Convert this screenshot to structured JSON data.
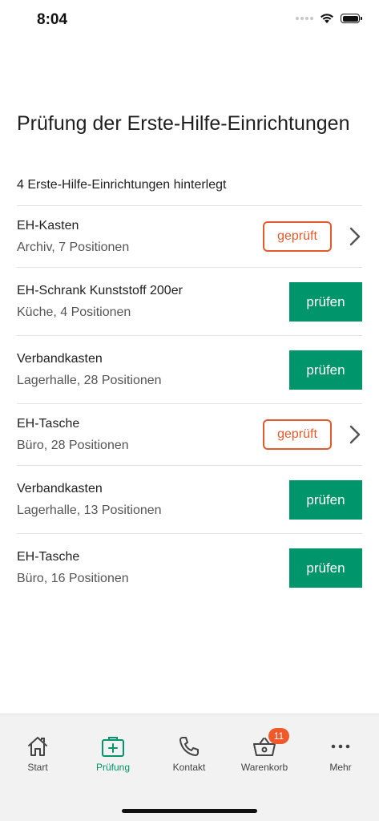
{
  "status_bar": {
    "time": "8:04"
  },
  "page": {
    "title": "Prüfung der Erste-Hilfe-Einrichtungen",
    "count_label": "4 Erste-Hilfe-Einrichtungen hinterlegt"
  },
  "items": [
    {
      "title": "EH-Kasten",
      "subtitle": "Archiv, 7 Positionen",
      "status": "geprüft"
    },
    {
      "title": "EH-Schrank Kunststoff 200er",
      "subtitle": "Küche, 4 Positionen",
      "action": "prüfen"
    },
    {
      "title": "Verbandkasten",
      "subtitle": "Lagerhalle, 28 Positionen",
      "action": "prüfen"
    },
    {
      "title": "EH-Tasche",
      "subtitle": "Büro, 28 Positionen",
      "status": "geprüft"
    },
    {
      "title": "Verbandkasten",
      "subtitle": "Lagerhalle, 13 Positionen",
      "action": "prüfen"
    },
    {
      "title": "EH-Tasche",
      "subtitle": "Büro, 16 Positionen",
      "action": "prüfen"
    }
  ],
  "tab_bar": {
    "tabs": [
      {
        "label": "Start",
        "icon": "home-icon"
      },
      {
        "label": "Prüfung",
        "icon": "first-aid-kit-icon"
      },
      {
        "label": "Kontakt",
        "icon": "phone-icon"
      },
      {
        "label": "Warenkorb",
        "icon": "basket-icon",
        "badge": "11"
      },
      {
        "label": "Mehr",
        "icon": "more-dots-icon"
      }
    ]
  },
  "colors": {
    "accent_green": "#00956a",
    "status_orange": "#e35b2d",
    "badge_orange": "#f0592a"
  }
}
